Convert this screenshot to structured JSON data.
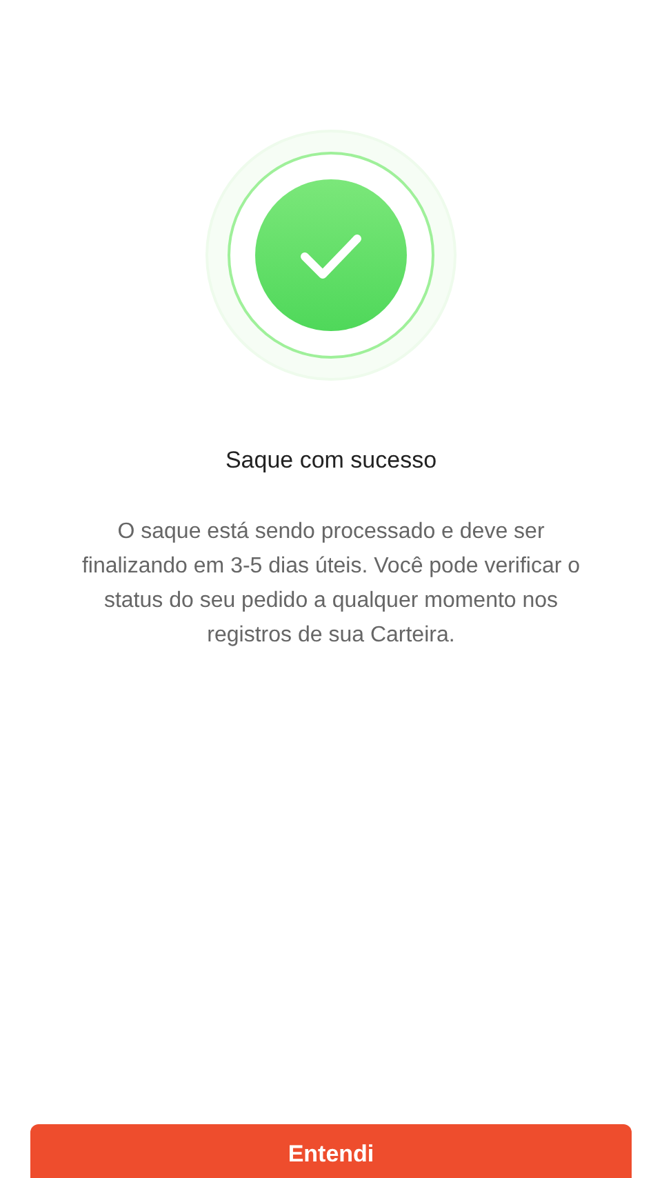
{
  "title": "Saque com sucesso",
  "message": "O saque está sendo processado e deve ser finalizando em 3-5 dias úteis. Você pode verificar o status do seu pedido a qualquer momento nos registros de sua Carteira.",
  "button": {
    "label": "Entendi"
  }
}
